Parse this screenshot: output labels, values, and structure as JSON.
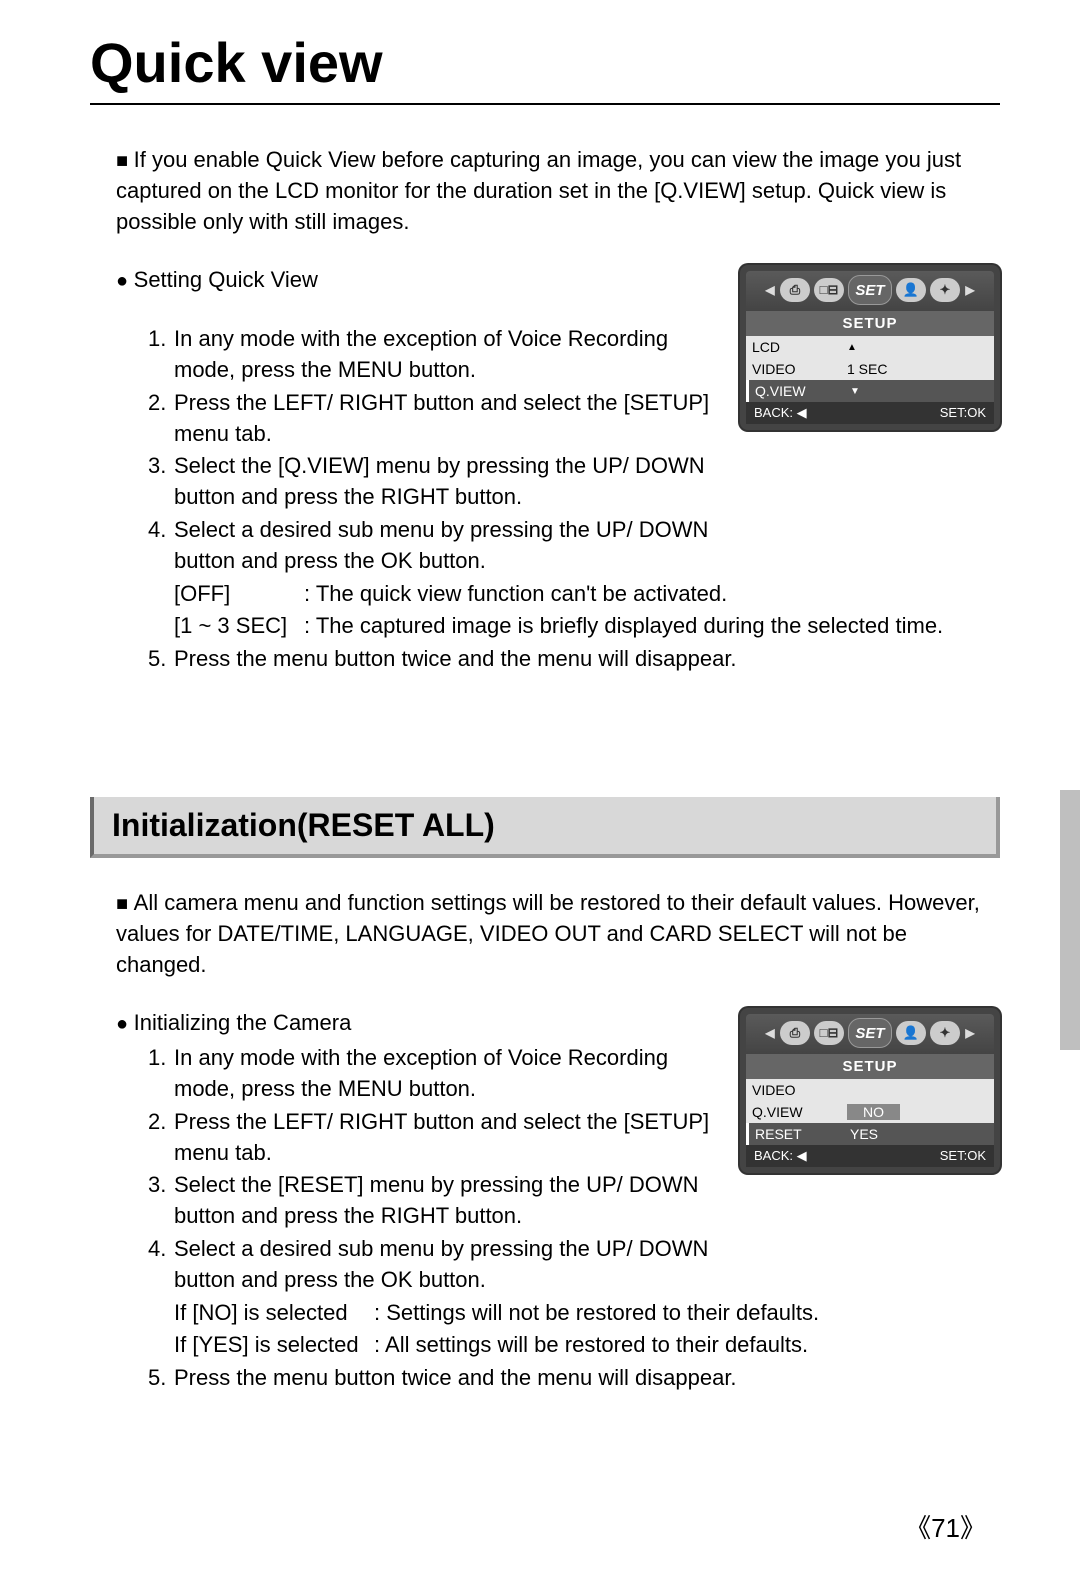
{
  "page_number": "《71》",
  "title": "Quick view",
  "intro": "If you enable Quick View before capturing an image, you can view the image you just captured on the LCD monitor for the duration set in the [Q.VIEW] setup. Quick view is possible only with still images.",
  "setting_heading": "Setting Quick View",
  "steps_qv": {
    "s1": "In any mode with the exception of Voice Recording mode, press the MENU button.",
    "s2": "Press the LEFT/ RIGHT button and select the [SETUP] menu tab.",
    "s3": "Select the [Q.VIEW] menu by pressing the UP/ DOWN button and press the RIGHT button.",
    "s4": "Select a desired sub menu by pressing the UP/ DOWN button and press the OK button.",
    "opt_off_label": "[OFF]",
    "opt_off_desc": "The quick view function can't be activated.",
    "opt_sec_label": "[1 ~ 3 SEC]",
    "opt_sec_desc": "The captured image is briefly displayed during the selected time.",
    "s5": "Press the menu button twice and the menu will disappear."
  },
  "lcd_qv": {
    "tab_set": "SET",
    "title": "SETUP",
    "row1": "LCD",
    "row2": "VIDEO",
    "row2_val": "1  SEC",
    "row3": "Q.VIEW",
    "footer_left": "BACK: ◀",
    "footer_right": "SET:OK"
  },
  "section2_heading": "Initialization(RESET ALL)",
  "reset_intro": "All camera menu and function settings will be restored to their default values. However, values for DATE/TIME, LANGUAGE, VIDEO OUT and CARD SELECT will not be changed.",
  "reset_heading": "Initializing the Camera",
  "steps_reset": {
    "s1": "In any mode with the exception of Voice Recording mode, press the MENU button.",
    "s2": "Press the LEFT/ RIGHT button and select the [SETUP] menu tab.",
    "s3": "Select the [RESET] menu by pressing the UP/ DOWN button and press the RIGHT button.",
    "s4": "Select a desired sub menu by pressing the UP/ DOWN button and press the OK button.",
    "opt_no_label": "If [NO] is selected",
    "opt_no_desc": "Settings will not be restored to their defaults.",
    "opt_yes_label": "If [YES] is selected",
    "opt_yes_desc": "All settings will be restored to their defaults.",
    "s5": "Press the menu button twice and the menu will disappear."
  },
  "lcd_reset": {
    "tab_set": "SET",
    "title": "SETUP",
    "row1": "VIDEO",
    "row2": "Q.VIEW",
    "row2_val": "NO",
    "row3": "RESET",
    "row3_val": "YES",
    "footer_left": "BACK: ◀",
    "footer_right": "SET:OK"
  }
}
